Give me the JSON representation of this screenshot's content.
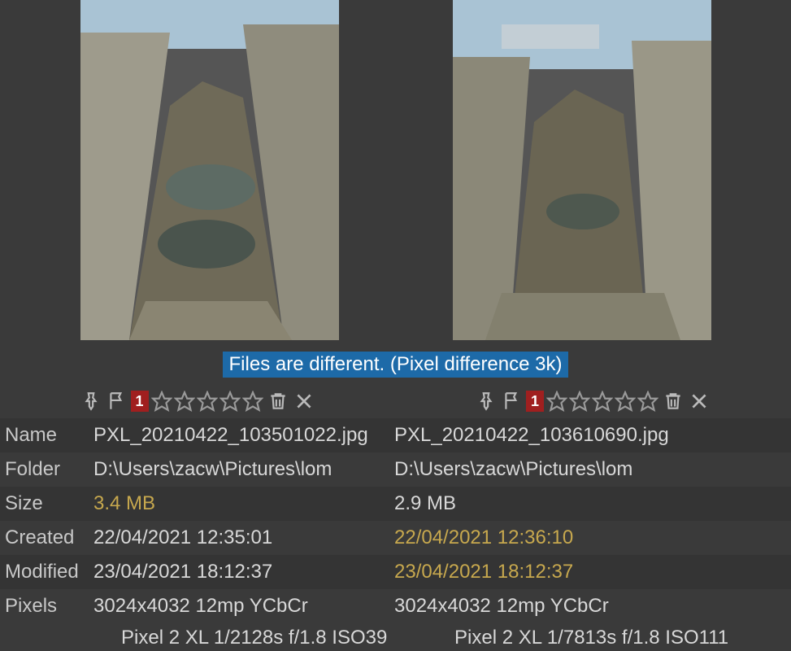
{
  "diff_banner": "Files are different. (Pixel difference 3k)",
  "labels": {
    "name": "Name",
    "folder": "Folder",
    "size": "Size",
    "created": "Created",
    "modified": "Modified",
    "pixels": "Pixels"
  },
  "left": {
    "badge": "1",
    "name": "PXL_20210422_103501022.jpg",
    "folder": "D:\\Users\\zacw\\Pictures\\lom",
    "size": "3.4 MB",
    "created": "22/04/2021 12:35:01",
    "modified": "23/04/2021 18:12:37",
    "pixels": "3024x4032 12mp YCbCr",
    "camera": "Pixel 2 XL 1/2128s f/1.8 ISO39"
  },
  "right": {
    "badge": "1",
    "name": "PXL_20210422_103610690.jpg",
    "folder": "D:\\Users\\zacw\\Pictures\\lom",
    "size": "2.9 MB",
    "created": "22/04/2021 12:36:10",
    "modified": "23/04/2021 18:12:37",
    "pixels": "3024x4032 12mp YCbCr",
    "camera": "Pixel 2 XL 1/7813s f/1.8 ISO111"
  },
  "highlights": {
    "left_size": true,
    "right_created": true,
    "right_modified": true
  }
}
